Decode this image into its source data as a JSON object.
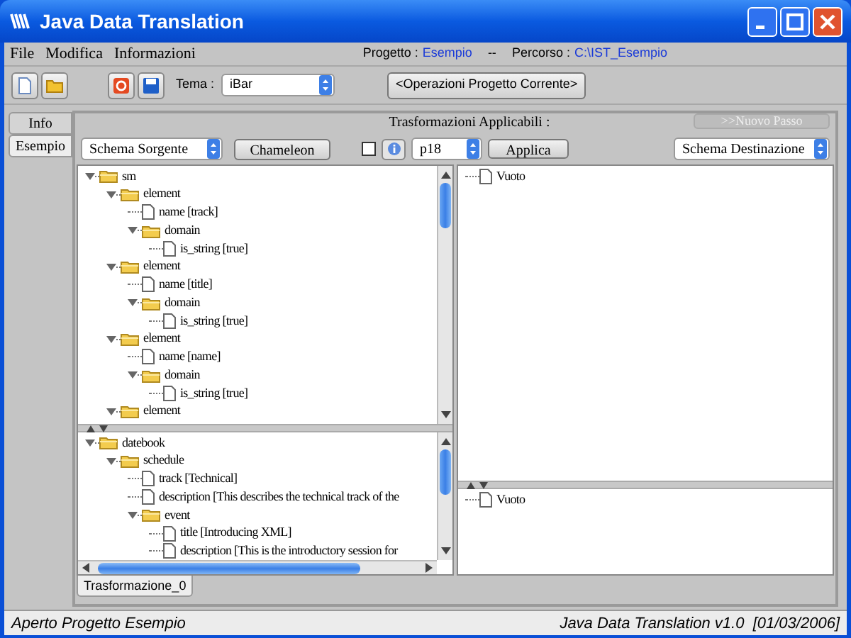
{
  "window": {
    "title": "Java Data Translation"
  },
  "menu": [
    "File",
    "Modifica",
    "Informazioni"
  ],
  "project": {
    "label": "Progetto :",
    "value": "Esempio",
    "separator": "--",
    "path_label": "Percorso :",
    "path_value": "C:\\IST_Esempio"
  },
  "toolbar": {
    "theme_label": "Tema :",
    "theme_value": "iBar",
    "operations": "<Operazioni Progetto Corrente>"
  },
  "side_tabs": [
    {
      "label": "Info",
      "selected": false
    },
    {
      "label": "Esempio",
      "selected": true
    }
  ],
  "transformations": {
    "title": "Trasformazioni Applicabili :",
    "next_step": {
      "label": ">>Nuovo Passo",
      "disabled": true
    },
    "source_schema": "Schema Sorgente",
    "chameleon": "Chameleon",
    "checked": false,
    "selection": "p18",
    "apply": "Applica",
    "target_schema": "Schema Destinazione"
  },
  "source_tree": [
    {
      "label": "sm",
      "kind": "folder",
      "expanded": true,
      "children": [
        {
          "label": "element",
          "kind": "folder",
          "expanded": true,
          "children": [
            {
              "label": "name  [track]",
              "kind": "file"
            },
            {
              "label": "domain",
              "kind": "folder",
              "expanded": true,
              "children": [
                {
                  "label": "is_string  [true]",
                  "kind": "file"
                }
              ]
            }
          ]
        },
        {
          "label": "element",
          "kind": "folder",
          "expanded": true,
          "children": [
            {
              "label": "name  [title]",
              "kind": "file"
            },
            {
              "label": "domain",
              "kind": "folder",
              "expanded": true,
              "children": [
                {
                  "label": "is_string  [true]",
                  "kind": "file"
                }
              ]
            }
          ]
        },
        {
          "label": "element",
          "kind": "folder",
          "expanded": true,
          "children": [
            {
              "label": "name  [name]",
              "kind": "file"
            },
            {
              "label": "domain",
              "kind": "folder",
              "expanded": true,
              "children": [
                {
                  "label": "is_string  [true]",
                  "kind": "file"
                }
              ]
            }
          ]
        },
        {
          "label": "element",
          "kind": "folder",
          "expanded": true
        }
      ]
    }
  ],
  "source_instance_tree": [
    {
      "label": "datebook",
      "kind": "folder",
      "expanded": true,
      "children": [
        {
          "label": "schedule",
          "kind": "folder",
          "expanded": true,
          "children": [
            {
              "label": "track  [Technical]",
              "kind": "file"
            },
            {
              "label": "description  [This describes the technical track of the",
              "kind": "file"
            },
            {
              "label": "event",
              "kind": "folder",
              "expanded": true,
              "children": [
                {
                  "label": "title  [Introducing XML]",
                  "kind": "file"
                },
                {
                  "label": "description  [This is the introductory session for",
                  "kind": "file"
                }
              ]
            }
          ]
        }
      ]
    }
  ],
  "target_tree": [
    {
      "label": "Vuoto",
      "kind": "file"
    }
  ],
  "target_instance_tree": [
    {
      "label": "Vuoto",
      "kind": "file"
    }
  ],
  "bottom_tabs": [
    {
      "label": "Trasformazione_0",
      "selected": true
    }
  ],
  "status_bar": {
    "left": "Aperto Progetto Esempio",
    "right": "Java Data Translation v1.0  [01/03/2006]"
  }
}
